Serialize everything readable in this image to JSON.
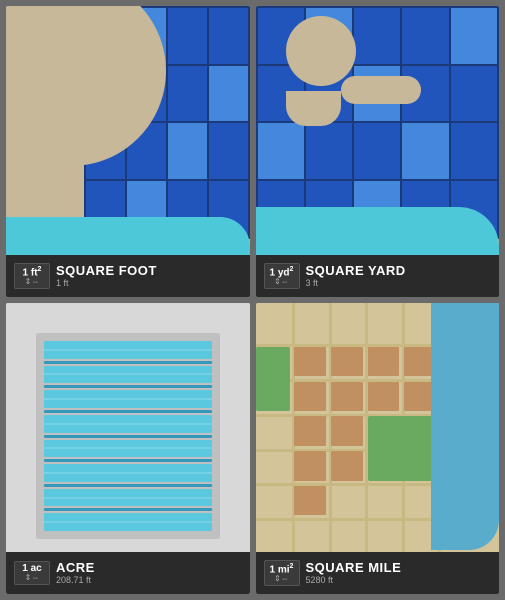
{
  "cards": [
    {
      "id": "square-foot",
      "unit": "1 ft²",
      "unit_sup": "2",
      "subtitle": "1 ft",
      "title": "SQUARE FOOT",
      "hasCyanStrip": true
    },
    {
      "id": "square-yard",
      "unit": "1 yd²",
      "unit_sup": "2",
      "subtitle": "3 ft",
      "title": "SQUARE YARD",
      "hasCyanStrip": true
    },
    {
      "id": "acre",
      "unit": "1 ac",
      "unit_sup": "",
      "subtitle": "208.71 ft",
      "title": "ACRE",
      "hasCyanStrip": false
    },
    {
      "id": "square-mile",
      "unit": "1 mi²",
      "unit_sup": "2",
      "subtitle": "5280 ft",
      "title": "SQUARE MILE",
      "hasCyanStrip": false
    }
  ]
}
